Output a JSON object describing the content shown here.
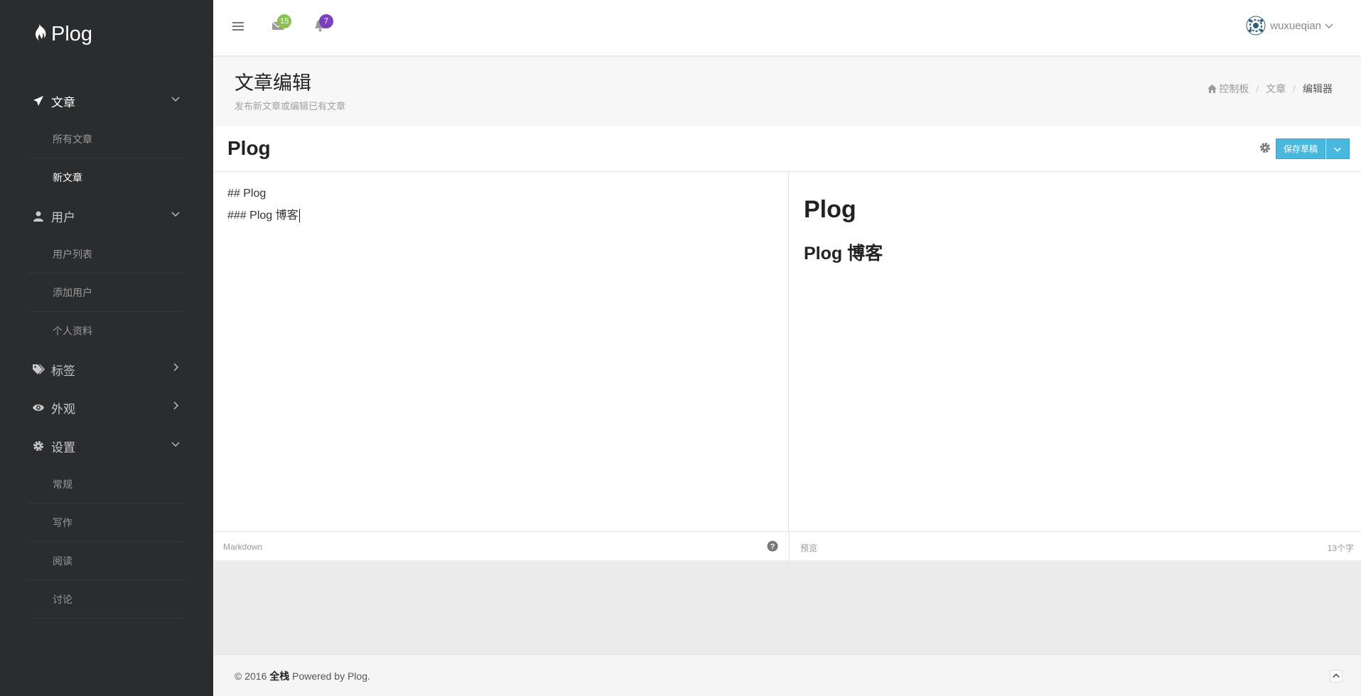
{
  "app": {
    "name": "Plog"
  },
  "sidebar": {
    "groups": [
      {
        "label": "文章",
        "items": [
          {
            "label": "所有文章"
          },
          {
            "label": "新文章"
          }
        ]
      },
      {
        "label": "用户",
        "items": [
          {
            "label": "用户列表"
          },
          {
            "label": "添加用户"
          },
          {
            "label": "个人资料"
          }
        ]
      },
      {
        "label": "标签"
      },
      {
        "label": "外观"
      },
      {
        "label": "设置",
        "items": [
          {
            "label": "常规"
          },
          {
            "label": "写作"
          },
          {
            "label": "阅读"
          },
          {
            "label": "讨论"
          }
        ]
      }
    ]
  },
  "topbar": {
    "messages_count": "15",
    "notifications_count": "7",
    "username": "wuxueqian"
  },
  "page": {
    "title": "文章编辑",
    "subtitle": "发布新文章或编辑已有文章"
  },
  "breadcrumb": {
    "home": "控制板",
    "section": "文章",
    "current": "编辑器"
  },
  "editor": {
    "post_title": "Plog",
    "save_label": "保存草稿",
    "source_lines": [
      "## Plog",
      "### Plog 博客"
    ],
    "preview_h2": "Plog",
    "preview_h3": "Plog 博客",
    "footer_left": "Markdown",
    "footer_mid": "预览",
    "word_count": "13个字"
  },
  "footer": {
    "copyright": "© 2016",
    "brand": "全栈",
    "powered": "Powered by Plog."
  },
  "colors": {
    "sidebar_bg": "#2b2c2e",
    "save_button": "#49b8de",
    "badge_green": "#8cc152",
    "badge_purple": "#7b3fbf"
  }
}
